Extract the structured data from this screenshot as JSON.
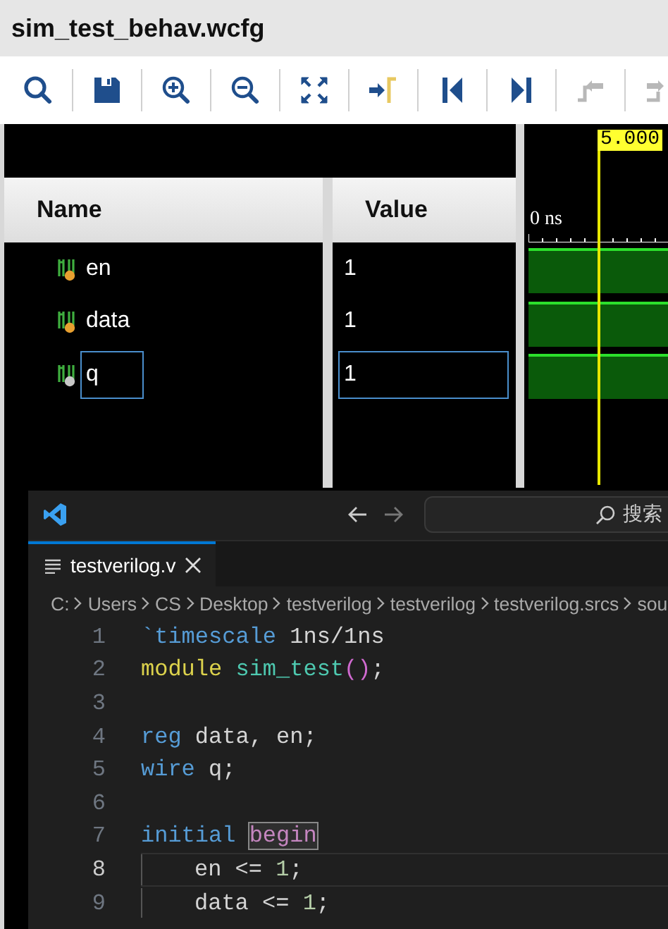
{
  "window": {
    "title": "sim_test_behav.wcfg"
  },
  "toolbar": [
    {
      "kind": "search",
      "disabled": false
    },
    {
      "kind": "save",
      "disabled": false
    },
    {
      "kind": "zoom-in",
      "disabled": false
    },
    {
      "kind": "zoom-out",
      "disabled": false
    },
    {
      "kind": "fit",
      "disabled": false
    },
    {
      "kind": "go-cursor",
      "disabled": false
    },
    {
      "kind": "go-start",
      "disabled": false
    },
    {
      "kind": "go-end",
      "disabled": false
    },
    {
      "kind": "prev-edge",
      "disabled": true
    },
    {
      "kind": "next-edge",
      "disabled": true
    }
  ],
  "columns": [
    "Name",
    "Value"
  ],
  "signals": [
    {
      "name": "en",
      "value": "1",
      "kind": "reg",
      "selected": false
    },
    {
      "name": "data",
      "value": "1",
      "kind": "reg",
      "selected": false
    },
    {
      "name": "q",
      "value": "1",
      "kind": "wire",
      "selected": true
    }
  ],
  "waveform": {
    "cursor": "5.000",
    "ruler": "0 ns"
  },
  "editor": {
    "search": {
      "placeholder": "搜索"
    },
    "tabs": [
      {
        "label": "testverilog.v",
        "selected": true
      }
    ],
    "breadcrumbs": [
      "C:",
      "Users",
      "CS",
      "Desktop",
      "testverilog",
      "testverilog",
      "testverilog.srcs",
      "sou"
    ],
    "lines": [
      {
        "number": "1",
        "current": false,
        "indented": false,
        "tokens": [
          {
            "text": "`timescale",
            "kind": "keyword"
          },
          {
            "text": " 1ns/1ns",
            "kind": "plain"
          }
        ]
      },
      {
        "number": "2",
        "current": false,
        "indented": false,
        "tokens": [
          {
            "text": "module ",
            "kind": "structure"
          },
          {
            "text": "sim_test",
            "kind": "name"
          },
          {
            "text": "()",
            "kind": "bracket"
          },
          {
            "text": ";",
            "kind": "plain"
          }
        ]
      },
      {
        "number": "3",
        "current": false,
        "indented": false
      },
      {
        "number": "4",
        "current": false,
        "indented": false,
        "tokens": [
          {
            "text": "reg",
            "kind": "keyword"
          },
          {
            "text": " data, en;",
            "kind": "plain"
          }
        ]
      },
      {
        "number": "5",
        "current": false,
        "indented": false,
        "tokens": [
          {
            "text": "wire",
            "kind": "keyword"
          },
          {
            "text": " q;",
            "kind": "plain"
          }
        ]
      },
      {
        "number": "6",
        "current": false,
        "indented": false
      },
      {
        "number": "7",
        "current": false,
        "indented": false,
        "tokens": [
          {
            "text": "initial ",
            "kind": "keyword"
          },
          {
            "text": "begin",
            "kind": "control",
            "matched": true
          }
        ]
      },
      {
        "number": "8",
        "current": true,
        "indented": true,
        "tokens": [
          {
            "text": "en <= ",
            "kind": "plain"
          },
          {
            "text": "1",
            "kind": "number"
          },
          {
            "text": ";",
            "kind": "plain"
          }
        ]
      },
      {
        "number": "9",
        "current": false,
        "indented": true,
        "tokens": [
          {
            "text": "data <= ",
            "kind": "plain"
          },
          {
            "text": "1",
            "kind": "number"
          },
          {
            "text": ";",
            "kind": "plain"
          }
        ]
      }
    ]
  }
}
